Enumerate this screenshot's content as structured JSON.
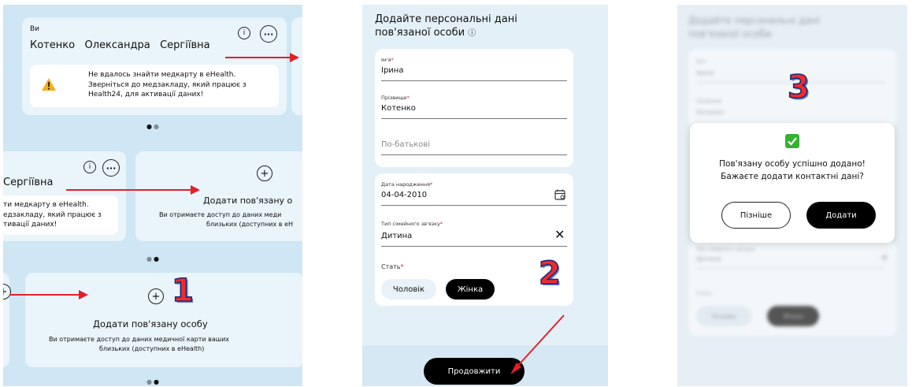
{
  "panel1": {
    "card1": {
      "owner_label": "Ви",
      "name": "Котенко   Олександра   Сергіївна",
      "warning_line1": "Не вдалось знайти медкарту в eHealth.",
      "warning_line2": "Зверніться до медзакладу, який працює з",
      "warning_line3": "Health24, для активації даних!"
    },
    "card2": {
      "name_partial": "Сергіївна",
      "warning_line1": "ти медкарту в eHealth.",
      "warning_line2": "едзакладу, який працює з",
      "warning_line3": "тивації даних!"
    },
    "add_card_partial": {
      "title": "Додати пов'язану о",
      "line1": "Ви отримаєте доступ до даних меди",
      "line2": "близьких (доступних в eH"
    },
    "add_card": {
      "title": "Додати пов'язану особу",
      "line1": "Ви отримаєте доступ до даних медичної карти ваших",
      "line2": "близьких (доступних в eHealth)"
    },
    "step": "1"
  },
  "panel2": {
    "title_line1": "Додайте персональні дані",
    "title_line2": "пов'язаної особи",
    "first_name_label": "Ім'я",
    "first_name_value": "Ірина",
    "last_name_label": "Прізвище",
    "last_name_value": "Котенко",
    "patronymic_placeholder": "По-батькові",
    "birth_label": "Дата народження",
    "birth_value": "04-04-2010",
    "relation_label": "Тип сімейного зв'язку",
    "relation_value": "Дитина",
    "gender_label": "Стать",
    "gender_male": "Чоловік",
    "gender_female": "Жінка",
    "continue_button": "Продовжити",
    "step": "2"
  },
  "panel3": {
    "bg_title_line1": "Додайте персональні дані",
    "bg_title_line2": "пов'язаної особи",
    "bg_first_label": "Ім'я",
    "bg_first_value": "Ірина",
    "bg_last_label": "Прізвище",
    "bg_last_value": "Котенко",
    "bg_relation_label": "Тип сімейного зв'язку",
    "bg_relation_value": "Дитина",
    "bg_gender_label": "Стать",
    "bg_gender_male": "Чоловік",
    "bg_gender_female": "Жінка",
    "modal_line1": "Пов'язану особу успішно додано!",
    "modal_line2": "Бажаєте додати контактні дані?",
    "later_button": "Пізніше",
    "add_button": "Додати",
    "step": "3"
  },
  "colors": {
    "accent_red": "#e2202a",
    "dark_button": "#000000",
    "success_green": "#34b233",
    "warning_yellow": "#f2b01e"
  }
}
